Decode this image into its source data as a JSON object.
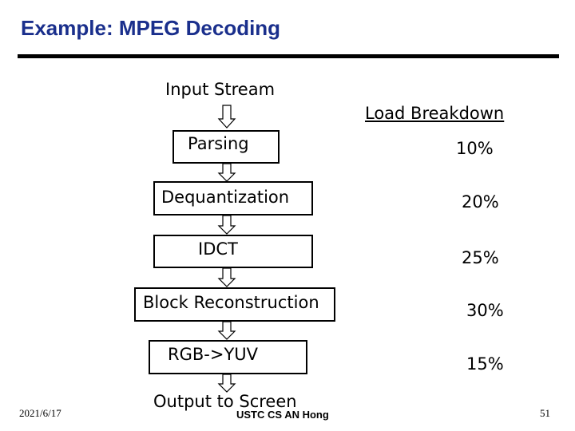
{
  "title": "Example: MPEG Decoding",
  "diagram": {
    "input": "Input Stream",
    "output": "Output to Screen",
    "breakdown_header": "Load Breakdown",
    "stages": [
      {
        "label": "Parsing",
        "load": "10%"
      },
      {
        "label": "Dequantization",
        "load": "20%"
      },
      {
        "label": "IDCT",
        "load": "25%"
      },
      {
        "label": "Block Reconstruction",
        "load": "30%"
      },
      {
        "label": "RGB->YUV",
        "load": "15%"
      }
    ]
  },
  "footer": {
    "date": "2021/6/17",
    "author": "USTC CS AN Hong",
    "page": "51"
  }
}
